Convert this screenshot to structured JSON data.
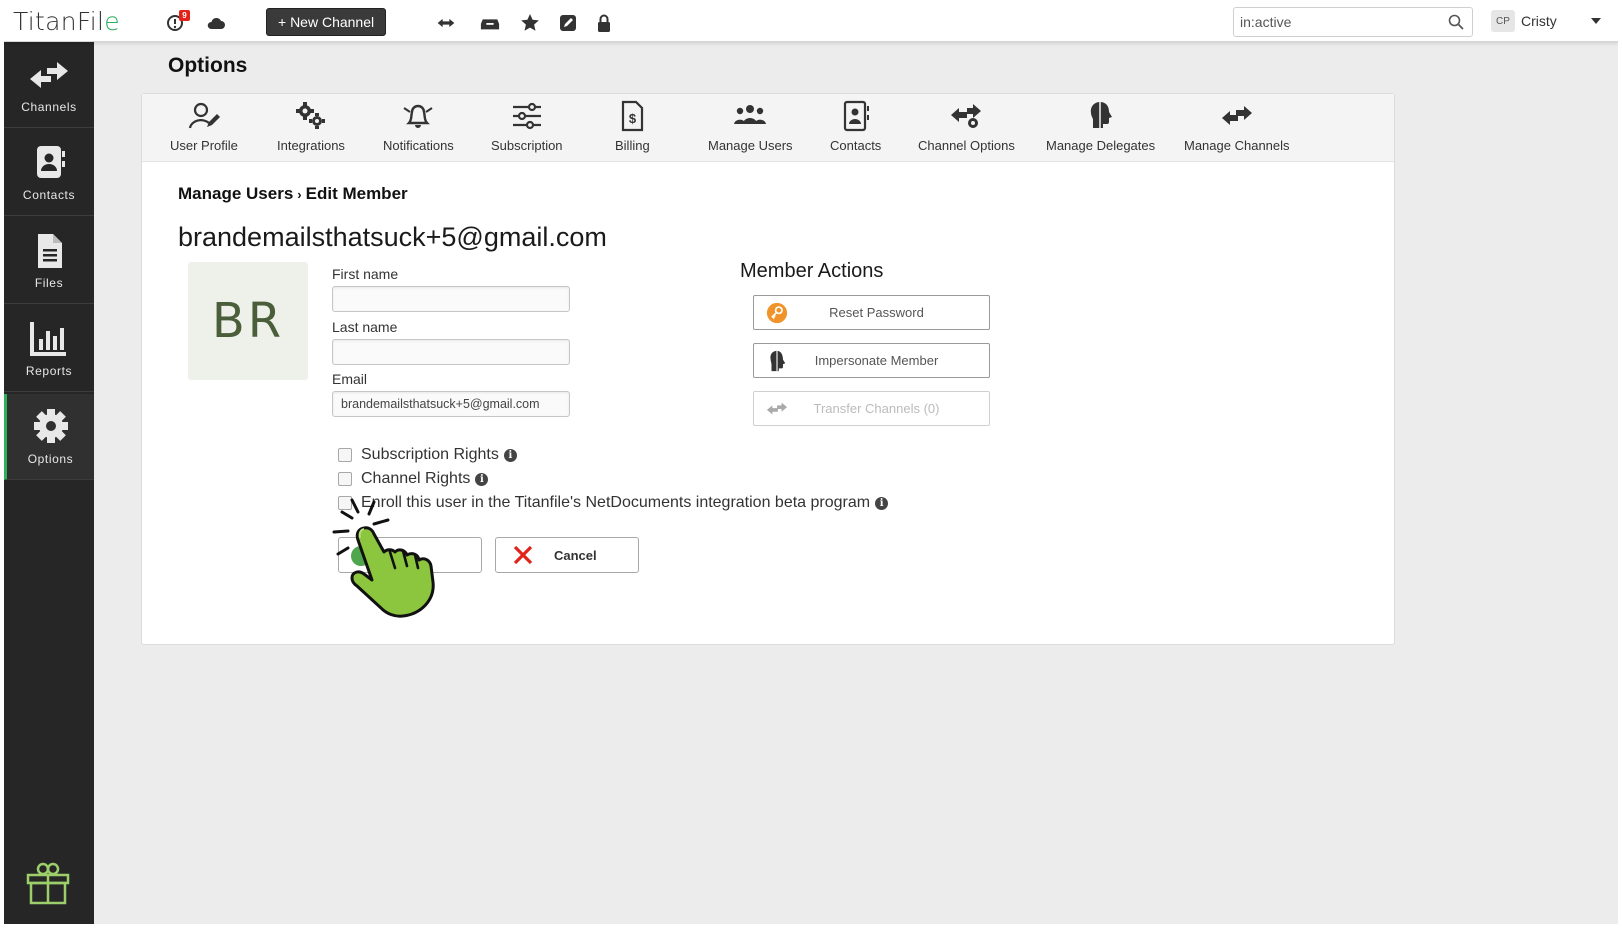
{
  "app": {
    "logo_main": "TitanFil",
    "logo_accent": "e"
  },
  "topbar": {
    "notification_count": "9",
    "new_channel_label": "+ New Channel",
    "search_value": "in:active",
    "user_initials": "CP",
    "user_name": "Cristy",
    "icons": [
      "alert-icon",
      "cloud-icon",
      "transfer-icon",
      "inbox-icon",
      "star-icon",
      "edit-icon",
      "lock-icon",
      "search-icon",
      "caret-down-icon"
    ]
  },
  "sidebar": {
    "items": [
      {
        "label": "Channels",
        "icon": "transfer-arrows-icon"
      },
      {
        "label": "Contacts",
        "icon": "contact-card-icon"
      },
      {
        "label": "Files",
        "icon": "file-icon"
      },
      {
        "label": "Reports",
        "icon": "bar-chart-icon"
      },
      {
        "label": "Options",
        "icon": "gear-icon"
      }
    ],
    "active": "Options",
    "footer_icon": "gift-icon"
  },
  "page": {
    "title": "Options"
  },
  "tabs": [
    {
      "label": "User Profile",
      "icon": "user-edit-icon"
    },
    {
      "label": "Integrations",
      "icon": "gears-icon"
    },
    {
      "label": "Notifications",
      "icon": "bell-icon"
    },
    {
      "label": "Subscription",
      "icon": "sliders-icon"
    },
    {
      "label": "Billing",
      "icon": "invoice-icon"
    },
    {
      "label": "Manage Users",
      "icon": "users-icon"
    },
    {
      "label": "Contacts",
      "icon": "contact-card-icon"
    },
    {
      "label": "Channel Options",
      "icon": "channel-gear-icon"
    },
    {
      "label": "Manage Delegates",
      "icon": "head-icon"
    },
    {
      "label": "Manage Channels",
      "icon": "transfer-arrows-icon"
    }
  ],
  "breadcrumb": {
    "parent": "Manage Users",
    "separator": "›",
    "current": "Edit Member"
  },
  "member": {
    "email_heading": "brandemailsthatsuck+5@gmail.com",
    "avatar_initials": "BR"
  },
  "form": {
    "first_name_label": "First name",
    "first_name_value": "",
    "last_name_label": "Last name",
    "last_name_value": "",
    "email_label": "Email",
    "email_value": "brandemailsthatsuck+5@gmail.com",
    "checkboxes": [
      {
        "label": "Subscription Rights",
        "checked": false
      },
      {
        "label": "Channel Rights",
        "checked": false
      },
      {
        "label": "Enroll this user in the Titanfile's NetDocuments integration beta program",
        "checked": false
      }
    ],
    "info_glyph": "i",
    "cancel_label": "Cancel"
  },
  "member_actions": {
    "title": "Member Actions",
    "buttons": [
      {
        "label": "Reset Password",
        "icon": "key-icon",
        "enabled": true
      },
      {
        "label": "Impersonate Member",
        "icon": "head-icon",
        "enabled": true
      },
      {
        "label": "Transfer Channels (0)",
        "icon": "transfer-arrows-icon",
        "enabled": false
      }
    ]
  },
  "colors": {
    "accent_green": "#2fae5b",
    "sidebar_bg": "#262626",
    "cancel_red": "#e2231a",
    "key_orange": "#f0932b",
    "pointer_green": "#8cc63f"
  },
  "overlay": {
    "icon": "pointing-hand-icon"
  }
}
